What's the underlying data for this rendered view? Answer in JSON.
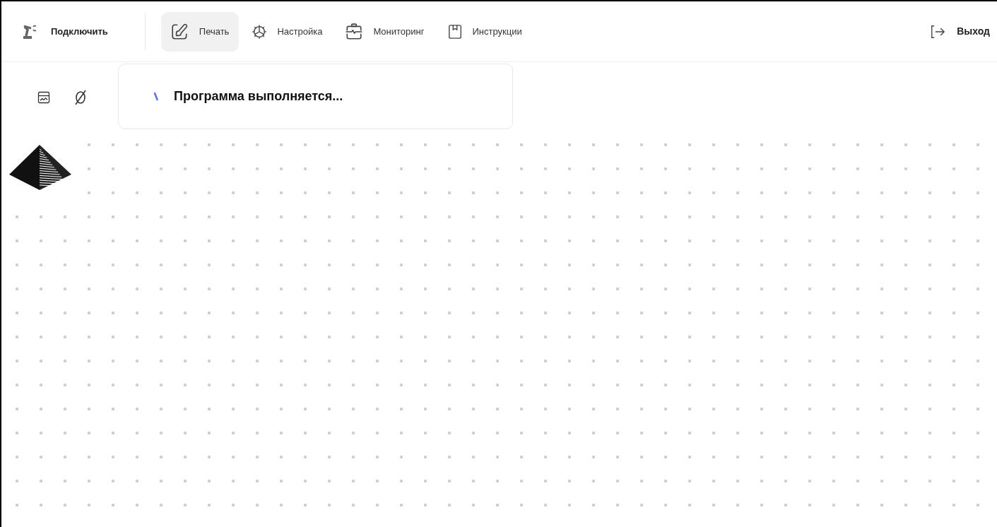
{
  "header": {
    "connect": {
      "label": "Подключить"
    },
    "tabs": [
      {
        "label": "Печать",
        "selected": true
      },
      {
        "label": "Настройка",
        "selected": false
      },
      {
        "label": "Мониторинг",
        "selected": false
      },
      {
        "label": "Инструкции",
        "selected": false
      }
    ],
    "logout": {
      "label": "Выход"
    }
  },
  "toast": {
    "message": "Программа выполняется..."
  }
}
